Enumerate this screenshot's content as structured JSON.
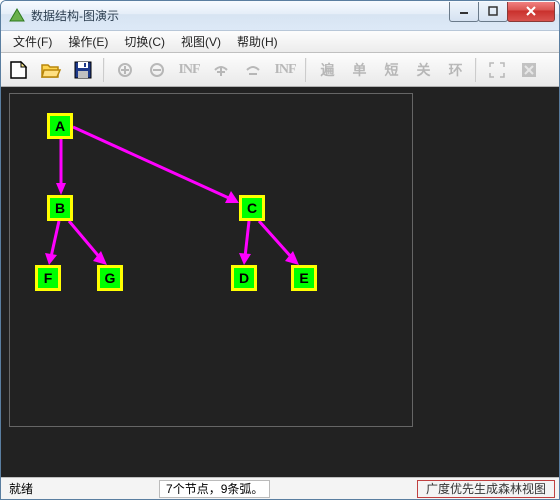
{
  "window": {
    "title": "数据结构-图演示"
  },
  "menu": {
    "file": "文件(F)",
    "operate": "操作(E)",
    "switch": "切换(C)",
    "view": "视图(V)",
    "help": "帮助(H)"
  },
  "toolbar_labels": {
    "inf1": "INF",
    "inf2": "INF",
    "bian": "遍",
    "dan": "单",
    "duan": "短",
    "guan": "关",
    "huan": "环"
  },
  "graph": {
    "nodes": {
      "A": "A",
      "B": "B",
      "C": "C",
      "D": "D",
      "E": "E",
      "F": "F",
      "G": "G"
    }
  },
  "chart_data": {
    "type": "graph",
    "directed": true,
    "nodes": [
      "A",
      "B",
      "C",
      "D",
      "E",
      "F",
      "G"
    ],
    "edges": [
      [
        "A",
        "B"
      ],
      [
        "A",
        "C"
      ],
      [
        "B",
        "F"
      ],
      [
        "B",
        "G"
      ],
      [
        "C",
        "D"
      ],
      [
        "C",
        "E"
      ]
    ],
    "title": "广度优先生成森林视图",
    "node_count": 7,
    "arc_count": 9
  },
  "status": {
    "ready": "就绪",
    "info": "7个节点，9条弧。",
    "mode": "广度优先生成森林视图"
  }
}
